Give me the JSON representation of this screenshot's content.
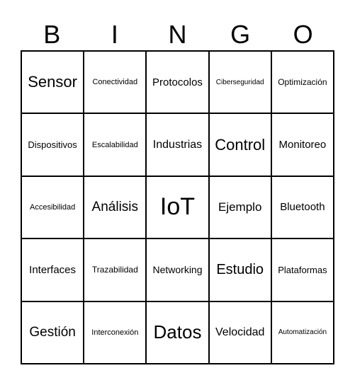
{
  "header": {
    "letters": [
      "B",
      "I",
      "N",
      "G",
      "O"
    ]
  },
  "grid": {
    "rows": [
      [
        "Sensor",
        "Conectividad",
        "Protocolos",
        "Ciberseguridad",
        "Optimización"
      ],
      [
        "Dispositivos",
        "Escalabilidad",
        "Industrias",
        "Control",
        "Monitoreo"
      ],
      [
        "Accesibilidad",
        "Análisis",
        "IoT",
        "Ejemplo",
        "Bluetooth"
      ],
      [
        "Interfaces",
        "Trazabilidad",
        "Networking",
        "Estudio",
        "Plataformas"
      ],
      [
        "Gestión",
        "Interconexión",
        "Datos",
        "Velocidad",
        "Automatización"
      ]
    ]
  }
}
